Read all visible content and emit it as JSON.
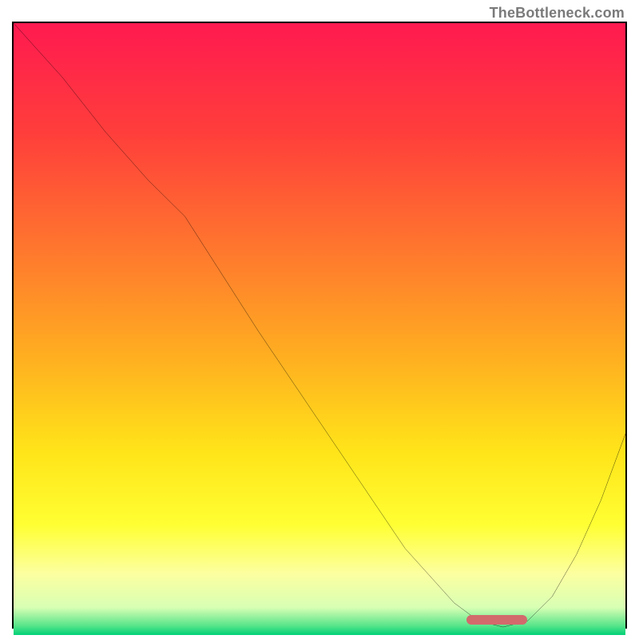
{
  "watermark": "TheBottleneck.com",
  "colors": {
    "border": "#000000",
    "curve": "#000000",
    "marker": "#d26a6c",
    "gradient_stops": [
      {
        "offset": 0.0,
        "color": "#ff1a50"
      },
      {
        "offset": 0.18,
        "color": "#ff3e3b"
      },
      {
        "offset": 0.38,
        "color": "#ff7a2d"
      },
      {
        "offset": 0.55,
        "color": "#ffb020"
      },
      {
        "offset": 0.7,
        "color": "#ffe419"
      },
      {
        "offset": 0.82,
        "color": "#ffff33"
      },
      {
        "offset": 0.9,
        "color": "#fcffa0"
      },
      {
        "offset": 0.955,
        "color": "#d8ffb4"
      },
      {
        "offset": 0.985,
        "color": "#57e58a"
      },
      {
        "offset": 1.0,
        "color": "#00d077"
      }
    ]
  },
  "chart_data": {
    "type": "line",
    "title": "",
    "xlabel": "",
    "ylabel": "",
    "xlim": [
      0,
      100
    ],
    "ylim": [
      0,
      100
    ],
    "legend": false,
    "grid": false,
    "series": [
      {
        "name": "bottleneck-curve",
        "x": [
          0,
          8,
          15,
          22,
          28,
          40,
          52,
          64,
          72,
          76,
          80,
          84,
          88,
          92,
          96,
          100
        ],
        "y": [
          100,
          91,
          82,
          74,
          68,
          49,
          31,
          13,
          4,
          1,
          0,
          1,
          5,
          12,
          21,
          32
        ]
      }
    ],
    "annotations": [
      {
        "name": "optimal-range-marker",
        "type": "segment",
        "x0": 74,
        "x1": 84,
        "y": 1.2
      }
    ],
    "note": "x and y are percent of plot area (0 = left/bottom, 100 = right/top); values read off image."
  }
}
